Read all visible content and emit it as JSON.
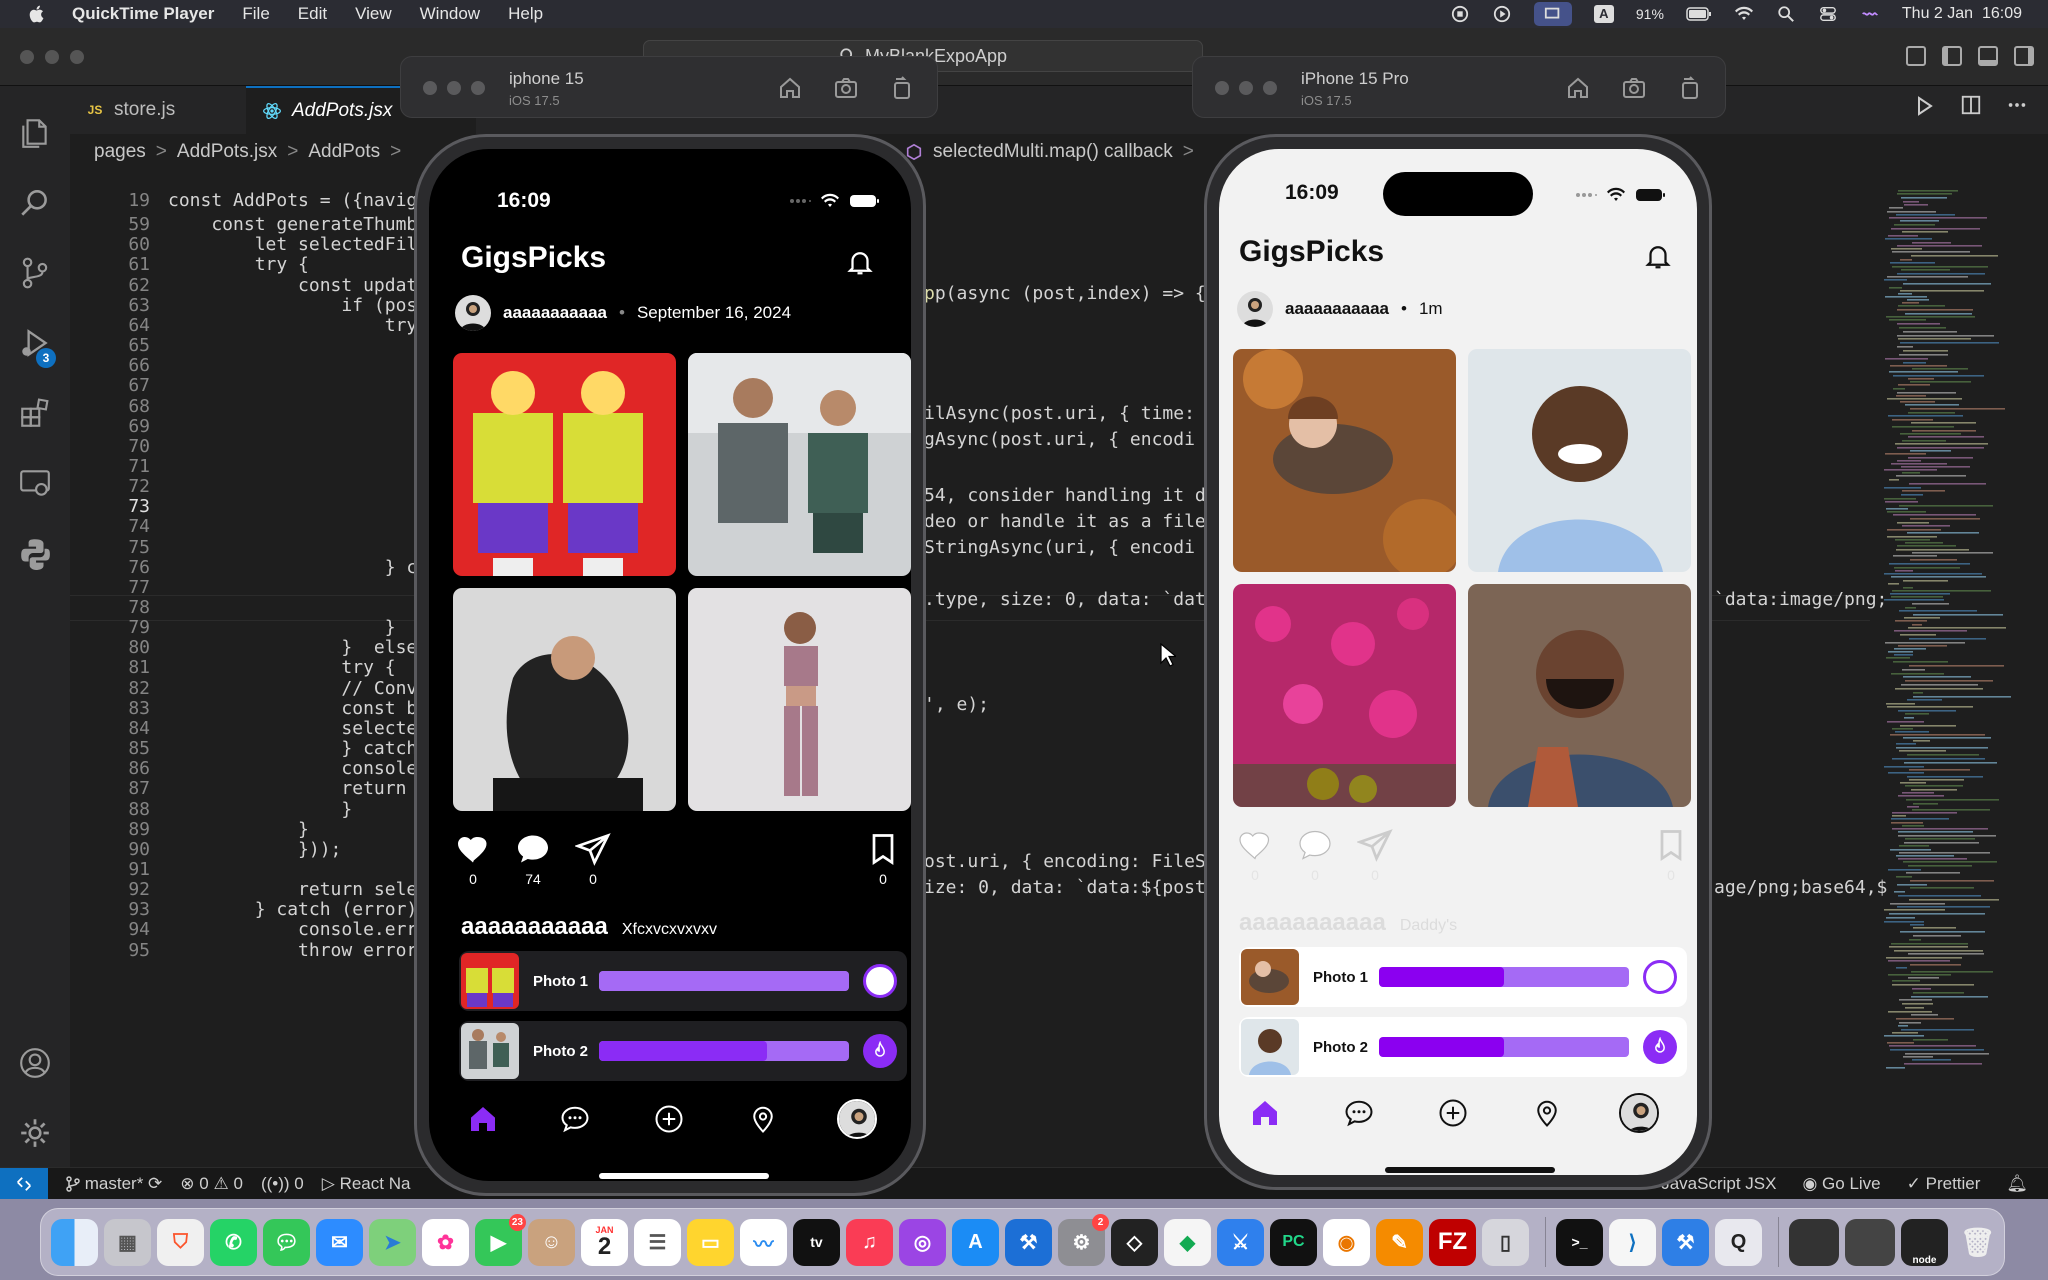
{
  "menubar": {
    "app_name": "QuickTime Player",
    "items": [
      "File",
      "Edit",
      "View",
      "Window",
      "Help"
    ],
    "battery": "91%",
    "clock": "Thu 2 Jan  16:09",
    "input_indicator": "A"
  },
  "vscode": {
    "command_center": "MyBlankExpoApp",
    "scm_badge": "3",
    "tabs": [
      {
        "label": "store.js",
        "icon": "JS"
      },
      {
        "label": "AddPots.jsx",
        "icon": "react"
      }
    ],
    "breadcrumb": [
      "pages",
      ">",
      "AddPots.jsx",
      ">",
      "AddPots",
      ">"
    ],
    "breadcrumb_right": [
      "selectedMulti.map() callback",
      ">"
    ],
    "line_numbers": [
      "19",
      "59",
      "60",
      "61",
      "62",
      "63",
      "64",
      "65",
      "66",
      "67",
      "68",
      "69",
      "70",
      "71",
      "72",
      "73",
      "74",
      "75",
      "76",
      "77",
      "78",
      "79",
      "80",
      "81",
      "82",
      "83",
      "84",
      "85",
      "86",
      "87",
      "88",
      "89",
      "90",
      "91",
      "92",
      "93",
      "94",
      "95"
    ],
    "current_line": "73",
    "code_left": {
      "l19": "const AddPots = ({naviga",
      "l59": "    const generateThumb",
      "l60": "        let selectedFil",
      "l61": "        try {",
      "l62": "            const updat",
      "l63": "                if (pos",
      "l64": "                    try",
      "l76": "                    } c",
      "l79": "                    }",
      "l80": "                }  else",
      "l81": "                try {",
      "l82": "                // Conv",
      "l83": "                const b",
      "l84": "                selecte",
      "l85": "                } catch",
      "l86": "                console",
      "l87": "                return",
      "l88": "                }",
      "l89": "            }",
      "l90": "            }));",
      "l92": "            return sele",
      "l93": "        } catch (error)",
      "l94": "            console.erro",
      "l95": "            throw error;"
    },
    "code_right": {
      "r62": "p(async (post,index) => {",
      "r66": "ilAsync(post.uri, { time:",
      "r67": "gAsync(post.uri, { encodi",
      "r69": "54, consider handling it d",
      "r70": "deo or handle it as a file",
      "r71": "StringAsync(uri, { encodi",
      "r73": ".type, size: 0, data: `dat",
      "r77": "', e);",
      "r83": "ost.uri, { encoding: FileS",
      "r84": "ize: 0, data: `data:${post",
      "r73b": "`data:image/png;",
      "r84b": "age/png;base64,$"
    },
    "status": {
      "branch": "master*",
      "errors": "0",
      "warnings": "0",
      "ports": "0",
      "run": "React Na",
      "language": "JavaScript JSX",
      "golive": "Go Live",
      "prettier": "Prettier"
    }
  },
  "simulators": [
    {
      "name": "iphone 15",
      "os": "iOS 17.5"
    },
    {
      "name": "iPhone 15 Pro",
      "os": "iOS 17.5"
    }
  ],
  "phone_left": {
    "time": "16:09",
    "app_title": "GigsPicks",
    "username": "aaaaaaaaaaa",
    "date": "September 16, 2024",
    "counts": {
      "likes": "0",
      "comments": "74",
      "shares": "0",
      "saves": "0"
    },
    "caption_user": "aaaaaaaaaaa",
    "caption_text": "Xfcxvcxvxvxv",
    "polls": [
      {
        "label": "Photo 1",
        "fill": 1.0
      },
      {
        "label": "Photo 2",
        "fill": 0.67
      }
    ]
  },
  "phone_right": {
    "time": "16:09",
    "app_title": "GigsPicks",
    "username": "aaaaaaaaaaa",
    "age": "1m",
    "counts": {
      "likes": "0",
      "comments": "0",
      "shares": "0",
      "saves": "0"
    },
    "caption_user": "aaaaaaaaaaa",
    "caption_text": "Daddy's",
    "polls": [
      {
        "label": "Photo 1",
        "fill": 0.5
      },
      {
        "label": "Photo 2",
        "fill": 0.5
      }
    ]
  },
  "dock": {
    "calendar_month": "JAN",
    "calendar_day": "2",
    "facetime_badge": "23",
    "settings_badge": "2",
    "node_label": "node"
  },
  "colors": {
    "accent_purple": "#8b2cf5",
    "bar_light": "#a56af5",
    "vscode_blue": "#0e70c0"
  }
}
